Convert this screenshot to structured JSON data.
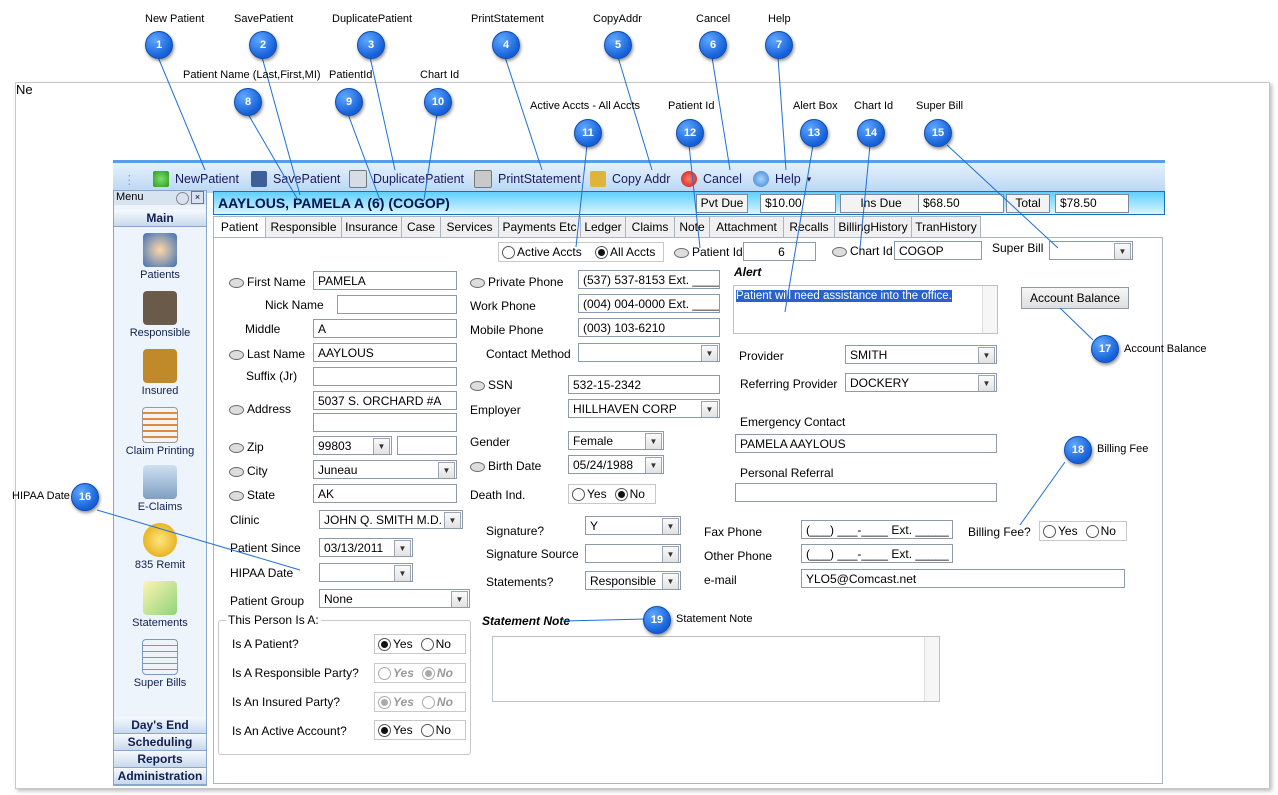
{
  "window": {
    "title_partial": "Ne"
  },
  "callouts": [
    {
      "num": "1",
      "label": "New Patient"
    },
    {
      "num": "2",
      "label": "SavePatient"
    },
    {
      "num": "3",
      "label": "DuplicatePatient"
    },
    {
      "num": "4",
      "label": "PrintStatement"
    },
    {
      "num": "5",
      "label": "CopyAddr"
    },
    {
      "num": "6",
      "label": "Cancel"
    },
    {
      "num": "7",
      "label": "Help"
    },
    {
      "num": "8",
      "label": "Patient Name (Last,First,MI)"
    },
    {
      "num": "9",
      "label": "PatientId"
    },
    {
      "num": "10",
      "label": "Chart Id"
    },
    {
      "num": "11",
      "label": "Active Accts - All Accts"
    },
    {
      "num": "12",
      "label": "Patient Id"
    },
    {
      "num": "13",
      "label": "Alert Box"
    },
    {
      "num": "14",
      "label": "Chart Id"
    },
    {
      "num": "15",
      "label": "Super Bill"
    },
    {
      "num": "16",
      "label": "HIPAA Date"
    },
    {
      "num": "17",
      "label": "Account Balance"
    },
    {
      "num": "18",
      "label": "Billing Fee"
    },
    {
      "num": "19",
      "label": "Statement Note"
    }
  ],
  "toolbar": {
    "new_patient": "NewPatient",
    "save_patient": "SavePatient",
    "duplicate_patient": "DuplicatePatient",
    "print_statement": "PrintStatement",
    "copy_addr": "Copy Addr",
    "cancel": "Cancel",
    "help": "Help"
  },
  "menu": {
    "title": "Menu",
    "main": "Main",
    "items": [
      "Patients",
      "Responsible",
      "Insured",
      "Claim Printing",
      "E-Claims",
      "835 Remit",
      "Statements",
      "Super Bills"
    ],
    "sections": [
      "Day's End",
      "Scheduling",
      "Reports",
      "Administration"
    ]
  },
  "header": {
    "patient_name": "AAYLOUS, PAMELA A (6) (COGOP)",
    "pvt_due_label": "Pvt Due",
    "pvt_due_value": "$10.00",
    "ins_due_label": "Ins Due",
    "ins_due_value": "$68.50",
    "total_label": "Total",
    "total_value": "$78.50"
  },
  "tabs": [
    "Patient",
    "Responsible",
    "Insurance",
    "Case",
    "Services",
    "Payments Etc",
    "Ledger",
    "Claims",
    "Note",
    "Attachment",
    "Recalls",
    "BillingHistory",
    "TranHistory"
  ],
  "accounts": {
    "active": "Active Accts",
    "all": "All Accts"
  },
  "ids": {
    "patient_id_label": "Patient Id",
    "patient_id": "6",
    "chart_id_label": "Chart Id",
    "chart_id": "COGOP",
    "super_bill_label": "Super Bill",
    "super_bill": ""
  },
  "patient": {
    "first_name_label": "First Name",
    "first_name": "PAMELA",
    "nick_name_label": "Nick Name",
    "nick_name": "",
    "middle_label": "Middle",
    "middle": "A",
    "last_name_label": "Last Name",
    "last_name": "AAYLOUS",
    "suffix_label": "Suffix (Jr)",
    "suffix": "",
    "address_label": "Address",
    "address1": "5037 S. ORCHARD #A",
    "address2": "",
    "zip_label": "Zip",
    "zip": "99803",
    "zip_ext": "",
    "city_label": "City",
    "city": "Juneau",
    "state_label": "State",
    "state": "AK",
    "clinic_label": "Clinic",
    "clinic": "JOHN Q. SMITH M.D. C",
    "patient_since_label": "Patient Since",
    "patient_since": "03/13/2011",
    "hipaa_label": "HIPAA Date",
    "hipaa": "",
    "group_label": "Patient Group",
    "group": "None"
  },
  "contact": {
    "private_phone_label": "Private Phone",
    "private_phone": "(537) 537-8153 Ext. _____",
    "work_phone_label": "Work Phone",
    "work_phone": "(004) 004-0000 Ext. _____",
    "mobile_phone_label": "Mobile Phone",
    "mobile_phone": "(003) 103-6210",
    "contact_method_label": "Contact Method",
    "contact_method": "",
    "ssn_label": "SSN",
    "ssn": "532-15-2342",
    "employer_label": "Employer",
    "employer": "HILLHAVEN CORP",
    "gender_label": "Gender",
    "gender": "Female",
    "birth_label": "Birth Date",
    "birth": "05/24/1988",
    "death_label": "Death Ind.",
    "yes": "Yes",
    "no": "No"
  },
  "alert": {
    "label": "Alert",
    "text": "Patient will need assistance into the office."
  },
  "account_balance_button": "Account Balance",
  "providers": {
    "provider_label": "Provider",
    "provider": "SMITH",
    "referring_label": "Referring Provider",
    "referring": "DOCKERY",
    "emergency_label": "Emergency Contact",
    "emergency": "PAMELA AAYLOUS",
    "referral_label": "Personal Referral",
    "referral": ""
  },
  "billing": {
    "signature_label": "Signature?",
    "signature": "Y",
    "sig_source_label": "Signature Source",
    "sig_source": "",
    "statements_label": "Statements?",
    "statements": "Responsible",
    "fax_label": "Fax Phone",
    "fax": "(___) ___-____ Ext. _____",
    "other_label": "Other Phone",
    "other": "(___) ___-____ Ext. _____",
    "email_label": "e-mail",
    "email": "YLO5@Comcast.net",
    "fee_label": "Billing Fee?"
  },
  "person_is": {
    "title": "This Person Is A:",
    "rows": [
      {
        "label": "Is A Patient?",
        "state": "Yes"
      },
      {
        "label": "Is A Responsible Party?",
        "state": "No"
      },
      {
        "label": "Is An Insured Party?",
        "state": "Yes"
      },
      {
        "label": "Is An Active Account?",
        "state": "Yes"
      }
    ]
  },
  "statement_note": {
    "label": "Statement Note",
    "text": ""
  },
  "colors": {
    "accent": "#1560d8",
    "header_bg": "#5fd0ff",
    "toolbar_border": "#5a9ce6"
  }
}
